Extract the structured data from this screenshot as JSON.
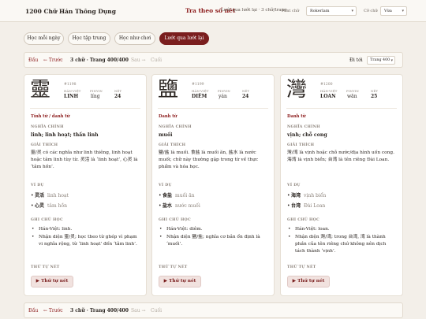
{
  "header": {
    "title": "1200 Chữ Hán Thông Dụng",
    "search_link": "Tra theo số nét",
    "mode_select": "Lướt qua lướt lại · 3 chữ/trang",
    "font_label": "Font chữ",
    "font_value": "Rokerlam",
    "size_label": "Cỡ chữ",
    "size_value": "Vừa"
  },
  "tabs": [
    "Học mỗi ngày",
    "Học tập trung",
    "Học như chơi",
    "Lướt qua lướt lại"
  ],
  "pager": {
    "first": "Đầu",
    "prev": "← Trước",
    "status": "3 chữ · Trang 400/400",
    "next": "Sau →",
    "last": "Cuối",
    "goto_label": "Đi tới",
    "page_value": "Trang 400"
  },
  "labels": {
    "hanviet": "HÁN-VIỆT",
    "pinyin": "PINYIN",
    "strokes": "NÉT",
    "meaning": "NGHĨA CHÍNH",
    "explain": "GIẢI THÍCH",
    "examples": "VÍ DỤ",
    "notes": "GHI CHÚ HỌC",
    "stroke_order": "THỨ TỰ NÉT",
    "stroke_button": "▶ Thứ tự nét"
  },
  "cards": [
    {
      "char": "靈",
      "num": "#1198",
      "hanviet": "LINH",
      "pinyin": "líng",
      "strokes": "24",
      "pos": "Tính từ / danh từ",
      "meaning": "linh; linh hoạt; thần linh",
      "explain": "靈/灵 có các nghĩa như linh thiêng, linh hoạt hoặc tâm linh tùy từ. 灵活 là ‘linh hoạt’, 心灵 là ‘tâm hồn’.",
      "examples": [
        {
          "word": "灵活",
          "reading": "linh hoạt"
        },
        {
          "word": "心灵",
          "reading": "tâm hồn"
        }
      ],
      "notes": [
        "Hán-Việt: linh.",
        "Nhận diện 靈/灵; học theo từ ghép vì phạm vi nghĩa rộng, từ ‘linh hoạt’ đến ‘tâm linh’."
      ]
    },
    {
      "char": "鹽",
      "num": "#1199",
      "hanviet": "DIÊM",
      "pinyin": "yán",
      "strokes": "24",
      "pos": "Danh từ",
      "meaning": "muối",
      "explain": "鹽/盐 là muối. 食盐 là muối ăn, 盐水 là nước muối; chữ này thường gặp trong từ về thực phẩm và hóa học.",
      "examples": [
        {
          "word": "食盐",
          "reading": "muối ăn"
        },
        {
          "word": "盐水",
          "reading": "nước muối"
        }
      ],
      "notes": [
        "Hán-Việt: diêm.",
        "Nhận diện 鹽/盐; nghĩa cơ bản ổn định là ‘muối’."
      ]
    },
    {
      "char": "灣",
      "num": "#1200",
      "hanviet": "LOAN",
      "pinyin": "wān",
      "strokes": "25",
      "pos": "Danh từ",
      "meaning": "vịnh; chỗ cong",
      "explain": "灣/湾 là vịnh hoặc chỗ nước/địa hình uốn cong. 海湾 là vịnh biển; 台湾 là tên riêng Đài Loan.",
      "examples": [
        {
          "word": "海湾",
          "reading": "vịnh biển"
        },
        {
          "word": "台湾",
          "reading": "Đài Loan"
        }
      ],
      "notes": [
        "Hán-Việt: loan.",
        "Nhận diện 灣/湾; trong 台湾, 湾 là thành phần của tên riêng chứ không nên dịch tách thành ‘vịnh’."
      ]
    }
  ]
}
